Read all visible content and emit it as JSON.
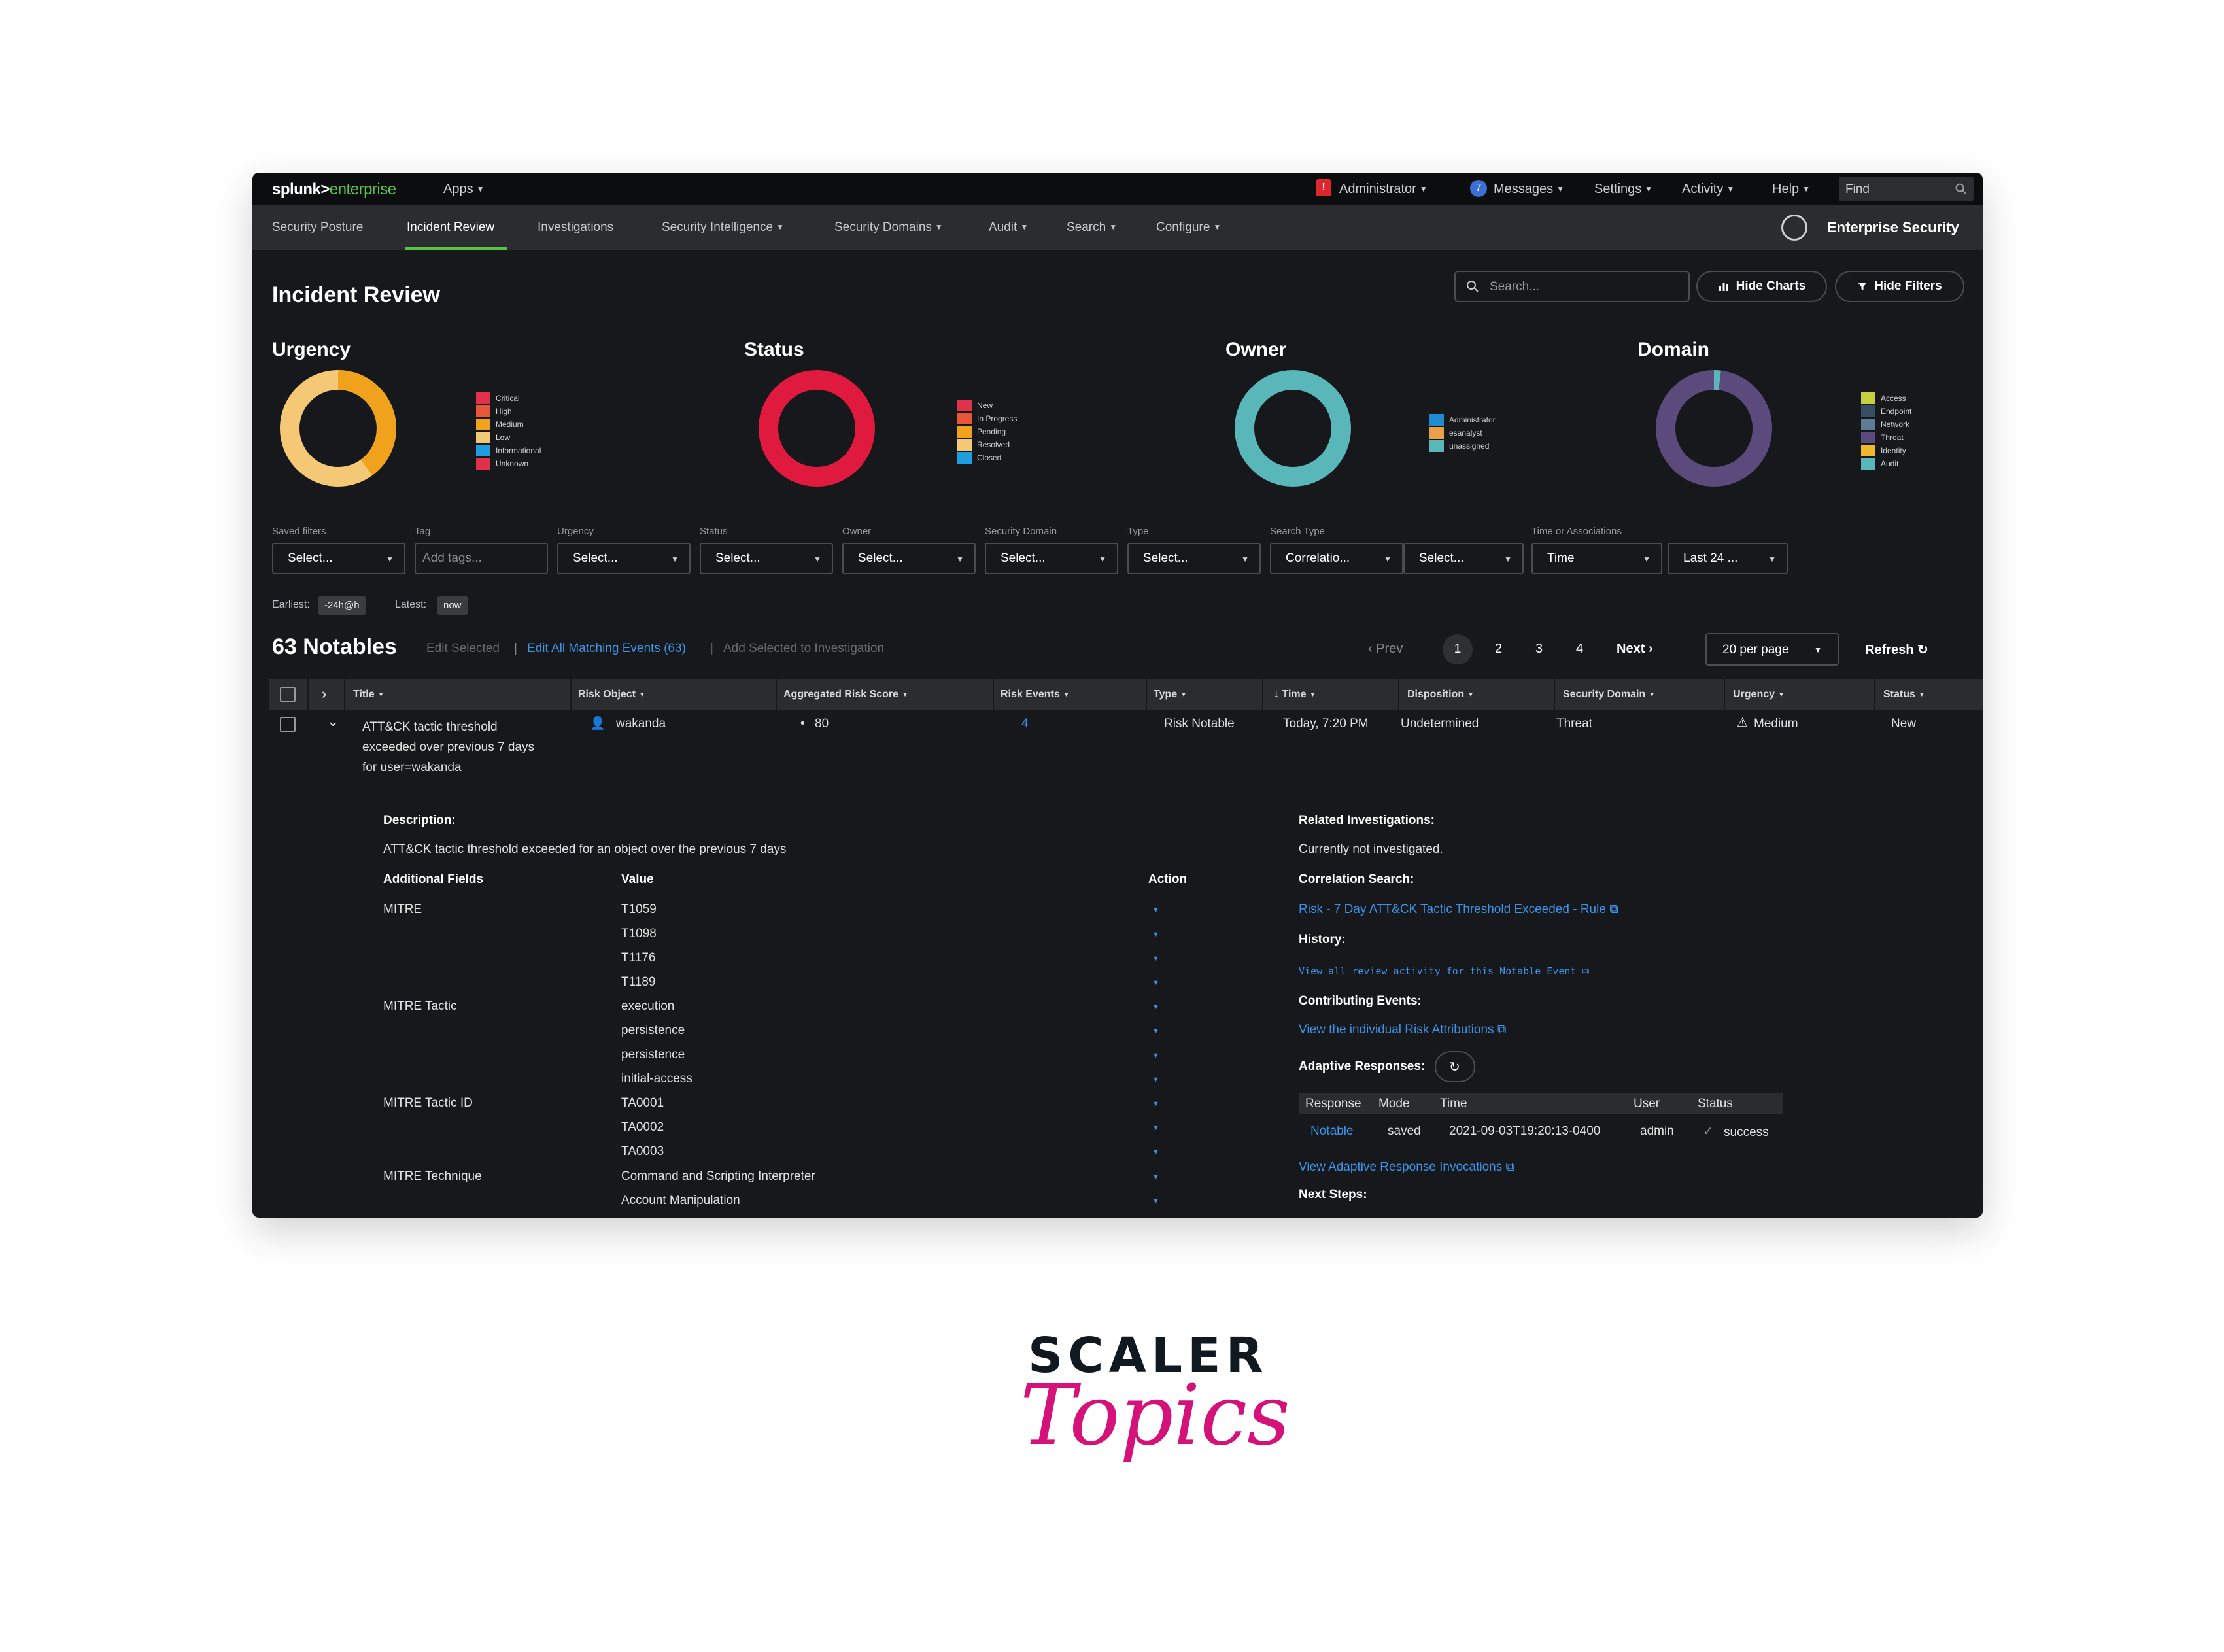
{
  "topbar": {
    "logo_main": "splunk>",
    "logo_sub": "enterprise",
    "apps": "Apps",
    "admin_badge": "!",
    "administrator": "Administrator",
    "messages_count": "7",
    "messages": "Messages",
    "settings": "Settings",
    "activity": "Activity",
    "help": "Help",
    "find_placeholder": "Find"
  },
  "nav": {
    "items": [
      "Security Posture",
      "Incident Review",
      "Investigations",
      "Security Intelligence",
      "Security Domains",
      "Audit",
      "Search",
      "Configure"
    ],
    "app_label": "Enterprise Security"
  },
  "header": {
    "title": "Incident Review",
    "search_placeholder": "Search...",
    "hide_charts": "Hide Charts",
    "hide_filters": "Hide Filters"
  },
  "charts": [
    {
      "title": "Urgency",
      "legend": [
        {
          "label": "Critical",
          "color": "#e0304b"
        },
        {
          "label": "High",
          "color": "#e8563a"
        },
        {
          "label": "Medium",
          "color": "#f0a21c"
        },
        {
          "label": "Low",
          "color": "#f5c875"
        },
        {
          "label": "Informational",
          "color": "#1e9de0"
        },
        {
          "label": "Unknown",
          "color": "#e0304b"
        }
      ]
    },
    {
      "title": "Status",
      "legend": [
        {
          "label": "New",
          "color": "#e0304b"
        },
        {
          "label": "In Progress",
          "color": "#e8563a"
        },
        {
          "label": "Pending",
          "color": "#f0a21c"
        },
        {
          "label": "Resolved",
          "color": "#f5c875"
        },
        {
          "label": "Closed",
          "color": "#1e9de0"
        }
      ]
    },
    {
      "title": "Owner",
      "legend": [
        {
          "label": "Administrator",
          "color": "#1f8ccf"
        },
        {
          "label": "esanalyst",
          "color": "#e8a04a"
        },
        {
          "label": "unassigned",
          "color": "#5ab7b9"
        }
      ]
    },
    {
      "title": "Domain",
      "legend": [
        {
          "label": "Access",
          "color": "#c6cf3e"
        },
        {
          "label": "Endpoint",
          "color": "#3a4d63"
        },
        {
          "label": "Network",
          "color": "#607b96"
        },
        {
          "label": "Threat",
          "color": "#5b4a7c"
        },
        {
          "label": "Identity",
          "color": "#f0b730"
        },
        {
          "label": "Audit",
          "color": "#5ab7b9"
        }
      ]
    }
  ],
  "filters": {
    "labels": [
      "Saved filters",
      "Tag",
      "Urgency",
      "Status",
      "Owner",
      "Security Domain",
      "Type",
      "Search Type",
      "Time or Associations"
    ],
    "saved": "Select...",
    "tag_placeholder": "Add tags...",
    "urgency": "Select...",
    "status": "Select...",
    "owner": "Select...",
    "security_domain": "Select...",
    "type": "Select...",
    "search_type": "Correlatio...",
    "search_type_2": "Select...",
    "time": "Time",
    "time_range": "Last 24 ...",
    "earliest_label": "Earliest:",
    "earliest_value": "-24h@h",
    "latest_label": "Latest:",
    "latest_value": "now"
  },
  "notables": {
    "count_label": "63 Notables",
    "edit_selected": "Edit Selected",
    "sep": "|",
    "edit_all": "Edit All Matching Events (63)",
    "add_selected": "Add Selected to Investigation",
    "prev": "Prev",
    "pages": [
      "1",
      "2",
      "3",
      "4"
    ],
    "next": "Next",
    "per_page": "20 per page",
    "refresh": "Refresh"
  },
  "table": {
    "headers": [
      "Title",
      "Risk Object",
      "Aggregated Risk Score",
      "Risk Events",
      "Type",
      "Time",
      "Disposition",
      "Security Domain",
      "Urgency",
      "Status"
    ],
    "row": {
      "title_lines": [
        "ATT&CK tactic threshold",
        "exceeded over previous 7 days",
        "for user=wakanda"
      ],
      "risk_object": "wakanda",
      "risk_score": "80",
      "risk_events": "4",
      "type": "Risk Notable",
      "time": "Today, 7:20 PM",
      "disposition": "Undetermined",
      "security_domain": "Threat",
      "urgency": "Medium",
      "status": "New"
    }
  },
  "details": {
    "description_label": "Description:",
    "description": "ATT&CK tactic threshold exceeded for an object over the previous 7 days",
    "additional_fields": "Additional Fields",
    "value": "Value",
    "action": "Action",
    "fields": [
      {
        "name": "MITRE",
        "values": [
          "T1059",
          "T1098",
          "T1176",
          "T1189"
        ]
      },
      {
        "name": "MITRE Tactic",
        "values": [
          "execution",
          "persistence",
          "persistence",
          "initial-access"
        ]
      },
      {
        "name": "MITRE Tactic ID",
        "values": [
          "TA0001",
          "TA0002",
          "TA0003"
        ]
      },
      {
        "name": "MITRE Technique",
        "values": [
          "Command and Scripting Interpreter",
          "Account Manipulation"
        ]
      }
    ],
    "related_label": "Related Investigations:",
    "related_value": "Currently not investigated.",
    "correlation_label": "Correlation Search:",
    "correlation_link": "Risk - 7 Day ATT&CK Tactic Threshold Exceeded - Rule",
    "history_label": "History:",
    "history_link": "View all review activity for this Notable Event",
    "contributing_label": "Contributing Events:",
    "contributing_link": "View the individual Risk Attributions",
    "adaptive_label": "Adaptive Responses:",
    "ar_headers": [
      "Response",
      "Mode",
      "Time",
      "User",
      "Status"
    ],
    "ar_row": {
      "response": "Notable",
      "mode": "saved",
      "time": "2021-09-03T19:20:13-0400",
      "user": "admin",
      "status": "success"
    },
    "ar_invocations": "View Adaptive Response Invocations",
    "next_steps_label": "Next Steps:"
  },
  "branding": {
    "line1": "SCALER",
    "line2": "Topics"
  }
}
